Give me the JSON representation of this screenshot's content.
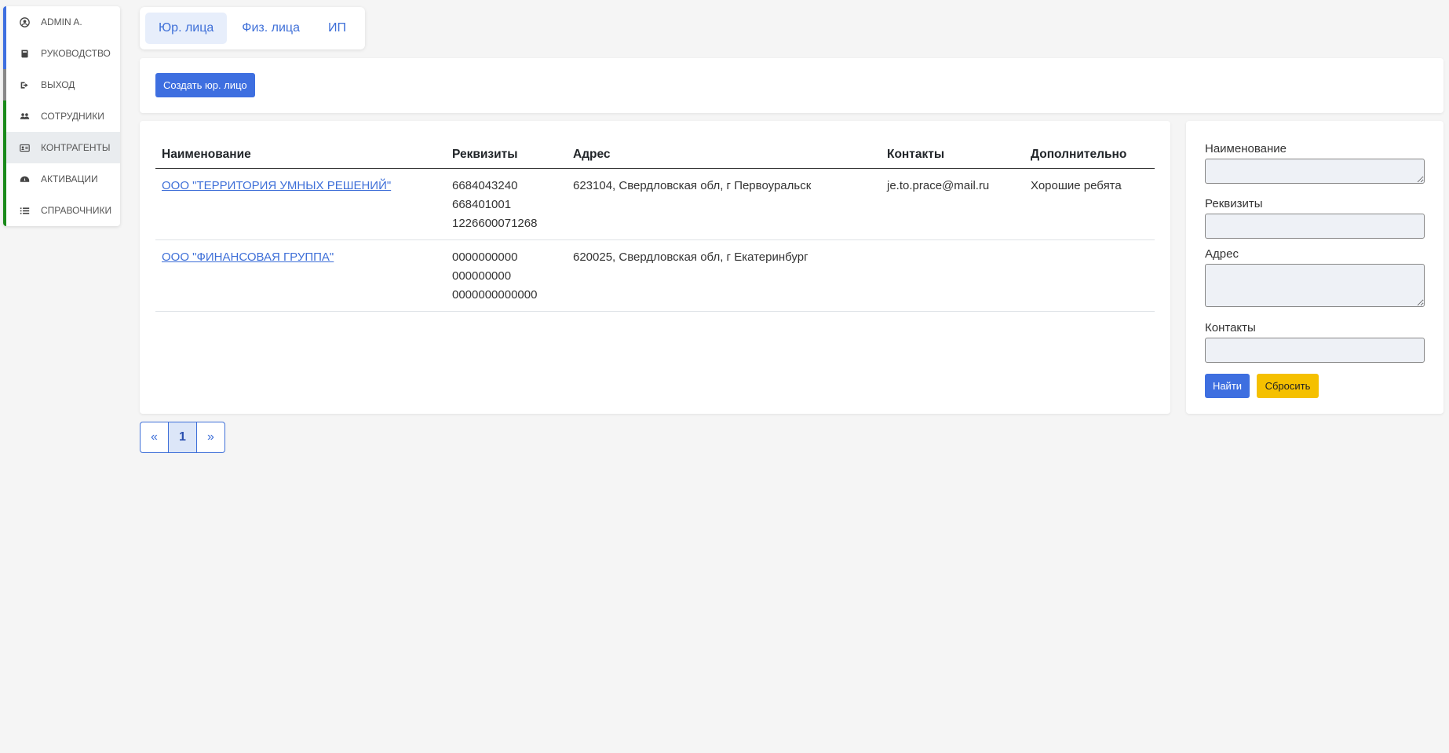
{
  "sidebar": {
    "items": [
      {
        "label": "ADMIN A.",
        "icon": "user-circle-icon",
        "bar_color": "#3e6fe0",
        "active": false
      },
      {
        "label": "РУКОВОДСТВО",
        "icon": "book-icon",
        "bar_color": "#3e6fe0",
        "active": false
      },
      {
        "label": "ВЫХОД",
        "icon": "sign-out-icon",
        "bar_color": "#888888",
        "active": false
      },
      {
        "label": "СОТРУДНИКИ",
        "icon": "users-icon",
        "bar_color": "#1a8a1a",
        "active": false
      },
      {
        "label": "КОНТРАГЕНТЫ",
        "icon": "id-card-icon",
        "bar_color": "#1a8a1a",
        "active": true
      },
      {
        "label": "АКТИВАЦИИ",
        "icon": "dashboard-icon",
        "bar_color": "#1a8a1a",
        "active": false
      },
      {
        "label": "СПРАВОЧНИКИ",
        "icon": "list-icon",
        "bar_color": "#1a8a1a",
        "active": false
      }
    ]
  },
  "tabs": [
    {
      "label": "Юр. лица",
      "active": true
    },
    {
      "label": "Физ. лица",
      "active": false
    },
    {
      "label": "ИП",
      "active": false
    }
  ],
  "create_button": "Создать юр. лицо",
  "table": {
    "headers": [
      "Наименование",
      "Реквизиты",
      "Адрес",
      "Контакты",
      "Дополнительно"
    ],
    "rows": [
      {
        "name": "ООО \"ТЕРРИТОРИЯ УМНЫХ РЕШЕНИЙ\"",
        "requisites": [
          "6684043240",
          "668401001",
          "1226600071268"
        ],
        "address": "623104, Свердловская обл, г Первоуральск",
        "contacts": "je.to.prace@mail.ru",
        "extra": "Хорошие ребята"
      },
      {
        "name": "ООО \"ФИНАНСОВАЯ ГРУППА\"",
        "requisites": [
          "0000000000",
          "000000000",
          "0000000000000"
        ],
        "address": "620025, Свердловская обл, г Екатеринбург",
        "contacts": "",
        "extra": ""
      }
    ]
  },
  "filter": {
    "name_label": "Наименование",
    "name_value": "",
    "requisites_label": "Реквизиты",
    "requisites_value": "",
    "address_label": "Адрес",
    "address_value": "",
    "contacts_label": "Контакты",
    "contacts_value": "",
    "find_button": "Найти",
    "reset_button": "Сбросить"
  },
  "pagination": {
    "prev": "«",
    "current": "1",
    "next": "»"
  },
  "colors": {
    "accent": "#3e6fe0",
    "warning": "#f5c000",
    "link": "#3e6fd8"
  }
}
